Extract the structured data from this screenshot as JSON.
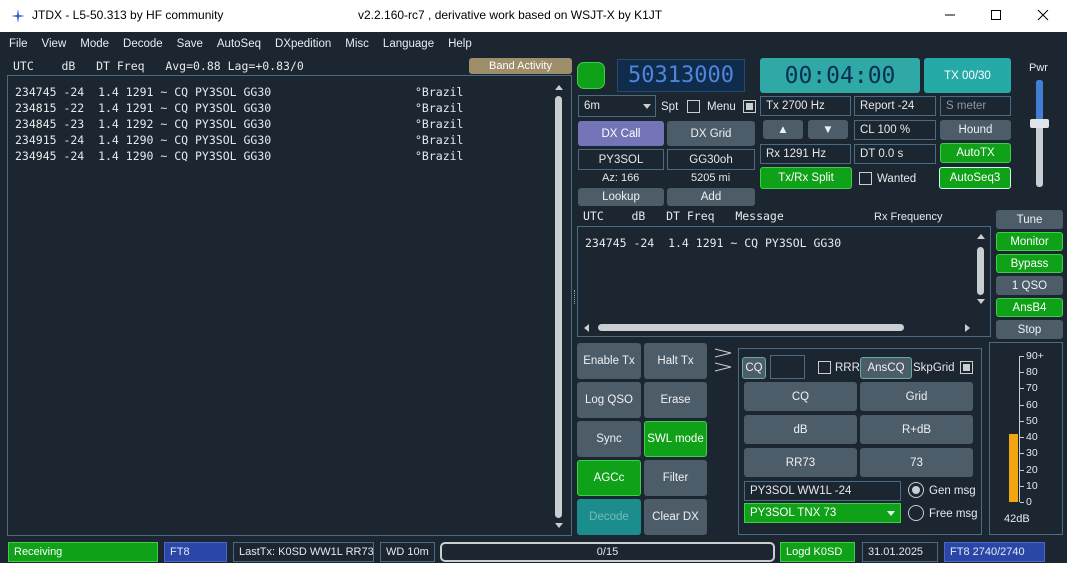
{
  "window": {
    "app_title": "JTDX - L5-50.313  by HF community",
    "version_title": "v2.2.160-rc7 , derivative work based on WSJT-X by K1JT"
  },
  "menu": [
    "File",
    "View",
    "Mode",
    "Decode",
    "Save",
    "AutoSeq",
    "DXpedition",
    "Misc",
    "Language",
    "Help"
  ],
  "band_activity": {
    "header": "UTC    dB   DT Freq   Avg=0.88 Lag=+0.83/0",
    "button": "Band Activity",
    "rows": [
      {
        "text": "234745 -24  1.4 1291 ~ CQ PY3SOL GG30",
        "country": "°Brazil"
      },
      {
        "text": "234815 -22  1.4 1291 ~ CQ PY3SOL GG30",
        "country": "°Brazil"
      },
      {
        "text": "234845 -23  1.4 1292 ~ CQ PY3SOL GG30",
        "country": "°Brazil"
      },
      {
        "text": "234915 -24  1.4 1290 ~ CQ PY3SOL GG30",
        "country": "°Brazil"
      },
      {
        "text": "234945 -24  1.4 1290 ~ CQ PY3SOL GG30",
        "country": "°Brazil"
      }
    ]
  },
  "freq": {
    "display": "50313000",
    "band": "6m",
    "spt_label": "Spt",
    "menu_label": "Menu"
  },
  "clock": {
    "time": "00:04:00",
    "tx_button": "TX 00/30"
  },
  "pwr_label": "Pwr",
  "dx": {
    "dx_call_btn": "DX Call",
    "dx_grid_btn": "DX Grid",
    "call": "PY3SOL",
    "grid": "GG30oh",
    "az": "Az: 166",
    "dist": "5205 mi",
    "lookup": "Lookup",
    "add": "Add"
  },
  "tx_rx": {
    "tx": "Tx  2700  Hz",
    "rx": "Rx  1291  Hz",
    "split": "Tx/Rx Split",
    "up": "▲",
    "down": "▼",
    "report": "Report -24",
    "cl": "CL  100 %",
    "dt": "DT  0.0 s",
    "wanted": "Wanted",
    "smeter": "S meter",
    "hound": "Hound",
    "autotx": "AutoTX",
    "autoseq": "AutoSeq3"
  },
  "rx_freq": {
    "header": "UTC    dB   DT Freq   Message",
    "header_right": "Rx Frequency",
    "rows": [
      "234745 -24  1.4 1291 ~ CQ PY3SOL GG30"
    ]
  },
  "side_buttons": [
    "Tune",
    "Monitor",
    "Bypass",
    "1 QSO",
    "AnsB4",
    "Stop"
  ],
  "controls": {
    "enable_tx": "Enable Tx",
    "halt_tx": "Halt Tx",
    "log_qso": "Log QSO",
    "erase": "Erase",
    "sync": "Sync",
    "swl": "SWL mode",
    "agcc": "AGCc",
    "filter": "Filter",
    "decode": "Decode",
    "clear_dx": "Clear DX"
  },
  "msg_panel": {
    "cq_label": "CQ",
    "rrr": "RRR",
    "anscq": "AnsCQ",
    "skpgrid": "SkpGrid",
    "buttons": [
      "CQ",
      "Grid",
      "dB",
      "R+dB",
      "RR73",
      "73"
    ],
    "gen_text": "PY3SOL WW1L -24",
    "free_text": "PY3SOL TNX 73",
    "gen_msg": "Gen msg",
    "free_msg": "Free msg"
  },
  "meter": {
    "ticks": [
      "90+",
      "80",
      "70",
      "60",
      "50",
      "40",
      "30",
      "20",
      "10",
      "0"
    ],
    "value_label": "42dB",
    "level": 42
  },
  "status": {
    "state": "Receiving",
    "mode": "FT8",
    "last_tx": "LastTx: K0SD WW1L RR73",
    "wd": "WD 10m",
    "progress": "0/15",
    "logd": "Logd K0SD",
    "date": "31.01.2025",
    "mode_right": "FT8  2740/2740"
  }
}
